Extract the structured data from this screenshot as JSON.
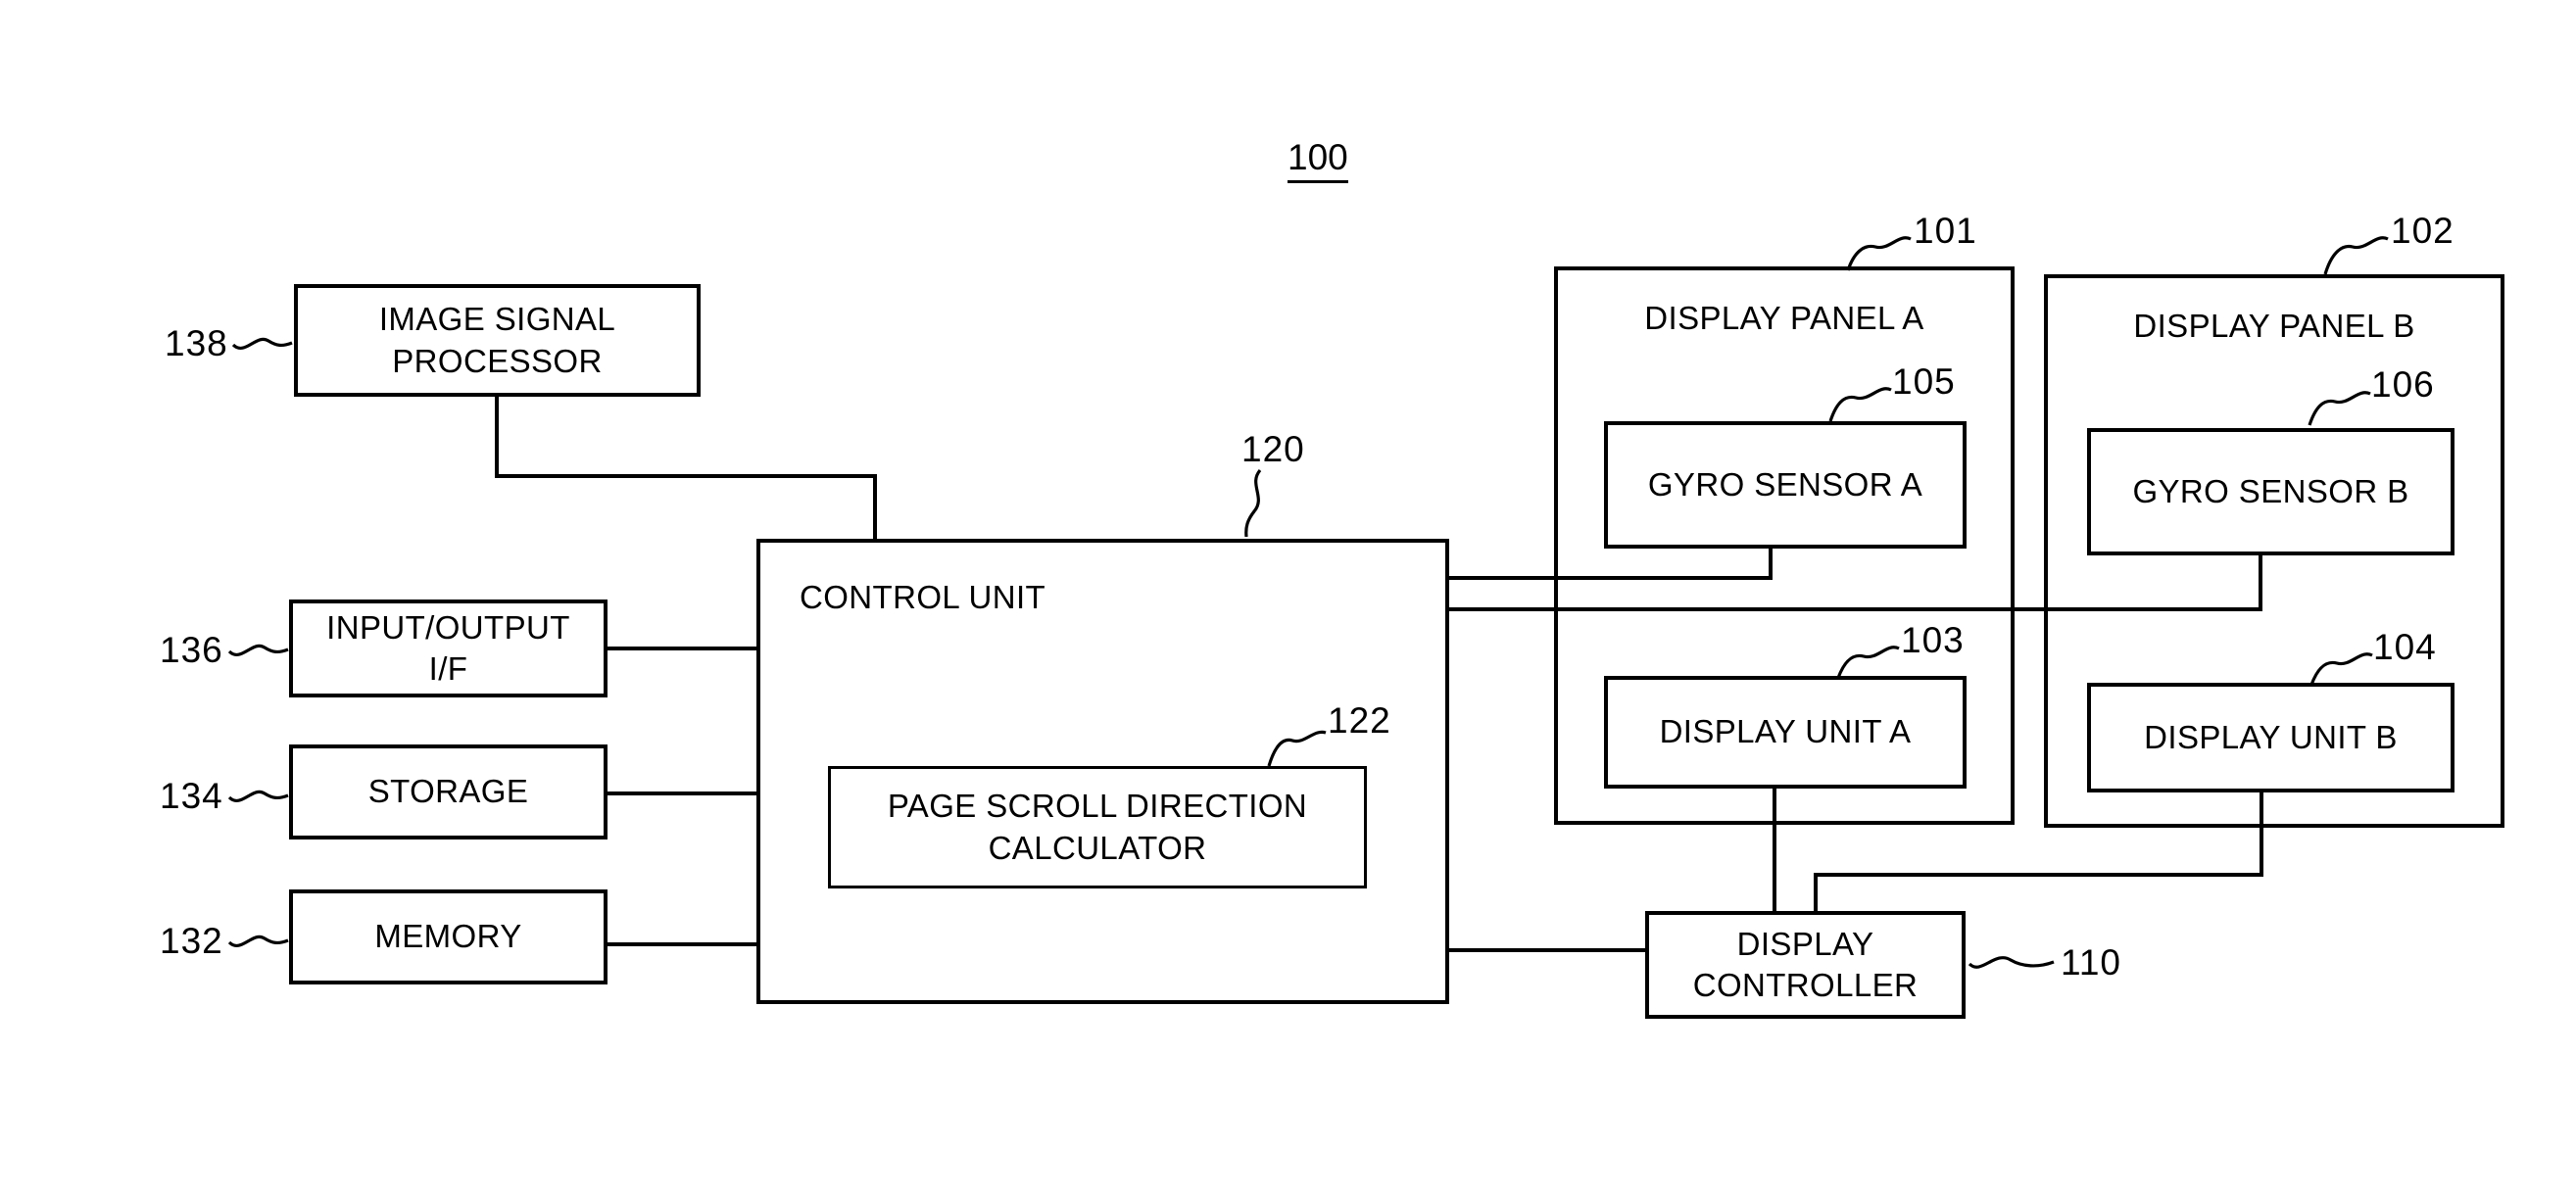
{
  "figure": {
    "system_ref": "100"
  },
  "blocks": {
    "image_signal_processor": {
      "label": "IMAGE SIGNAL\nPROCESSOR",
      "line1": "IMAGE SIGNAL",
      "line2": "PROCESSOR",
      "ref": "138"
    },
    "input_output_if": {
      "label": "INPUT/OUTPUT\nI/F",
      "line1": "INPUT/OUTPUT",
      "line2": "I/F",
      "ref": "136"
    },
    "storage": {
      "label": "STORAGE",
      "ref": "134"
    },
    "memory": {
      "label": "MEMORY",
      "ref": "132"
    },
    "control_unit": {
      "label": "CONTROL UNIT",
      "ref": "120"
    },
    "page_scroll_direction_calculator": {
      "label": "PAGE SCROLL DIRECTION\nCALCULATOR",
      "line1": "PAGE SCROLL DIRECTION",
      "line2": "CALCULATOR",
      "ref": "122"
    },
    "display_panel_a": {
      "label": "DISPLAY PANEL A",
      "ref": "101"
    },
    "display_panel_b": {
      "label": "DISPLAY PANEL B",
      "ref": "102"
    },
    "gyro_sensor_a": {
      "label": "GYRO SENSOR A",
      "ref": "105"
    },
    "gyro_sensor_b": {
      "label": "GYRO SENSOR B",
      "ref": "106"
    },
    "display_unit_a": {
      "label": "DISPLAY UNIT A",
      "ref": "103"
    },
    "display_unit_b": {
      "label": "DISPLAY UNIT B",
      "ref": "104"
    },
    "display_controller": {
      "label": "DISPLAY\nCONTROLLER",
      "line1": "DISPLAY",
      "line2": "CONTROLLER",
      "ref": "110"
    }
  },
  "colors": {
    "ink": "#000000",
    "paper": "#ffffff"
  }
}
